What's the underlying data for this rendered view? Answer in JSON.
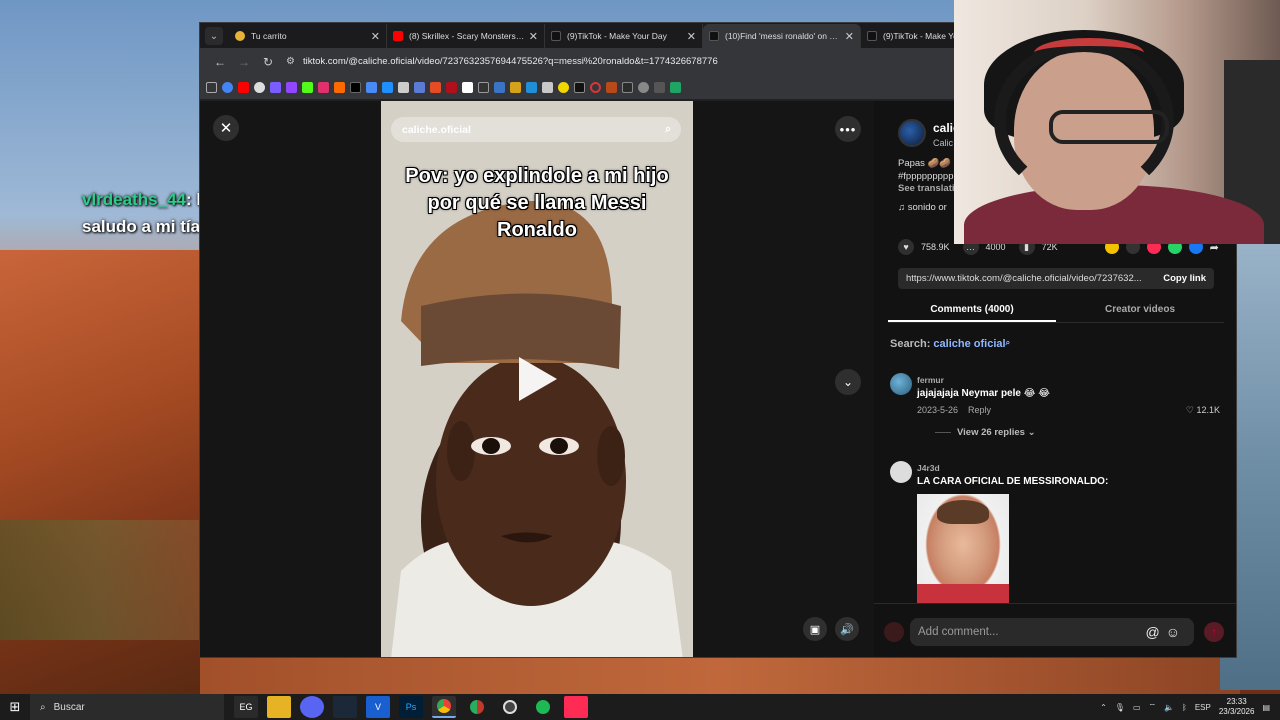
{
  "overlay_chat": {
    "username": "vlrdeaths_44",
    "message": ": kota puedes mandarle un saludo a mi tía rosa melano? 🙏"
  },
  "browser": {
    "tabs": [
      {
        "title": "Tu carrito",
        "active": false,
        "color": "#e8b339"
      },
      {
        "title": "(8) Skrillex - Scary Monsters And",
        "active": false,
        "color": "#ff0000"
      },
      {
        "title": "(9)TikTok - Make Your Day",
        "active": false,
        "color": "#111111"
      },
      {
        "title": "(10)Find 'messi ronaldo' on TikTok",
        "active": true,
        "color": "#111111"
      },
      {
        "title": "(9)TikTok - Make Your Day",
        "active": false,
        "color": "#111111"
      }
    ],
    "url": "tiktok.com/@caliche.oficial/video/7237632357694475526?q=messi%20ronaldo&t=1774326678776"
  },
  "video": {
    "search_text": "caliche.oficial",
    "caption": "Pov: yo explindole a mi hijo por qué se llama Messi Ronaldo"
  },
  "panel": {
    "author_name": "calic",
    "author_handle": "Calic",
    "description_line1": "Papas 🥔🥔",
    "description_line2": "#fppppppppp",
    "see_translation": "See translati",
    "music": "♫  sonido or",
    "likes": "758.9K",
    "comments_count": "4000",
    "saves": "72K",
    "link": "https://www.tiktok.com/@caliche.oficial/video/7237632...",
    "copy_link": "Copy link",
    "tab_comments": "Comments (4000)",
    "tab_creator": "Creator videos",
    "search_prefix": "Search: ",
    "search_keyword": "caliche oficial",
    "comments": [
      {
        "user": "fermur",
        "text": "jajajajaja Neymar pele 😂 😂",
        "date": "2023-5-26",
        "reply": "Reply",
        "likes": "12.1K",
        "view_replies": "View 26 replies ⌄"
      },
      {
        "user": "J4r3d",
        "text": "LA CARA OFICIAL DE MESSIRONALDO:"
      }
    ],
    "add_comment_placeholder": "Add comment..."
  },
  "taskbar": {
    "search": "Buscar",
    "lang": "ESP",
    "time": "23:33",
    "date": "23/3/2026"
  }
}
